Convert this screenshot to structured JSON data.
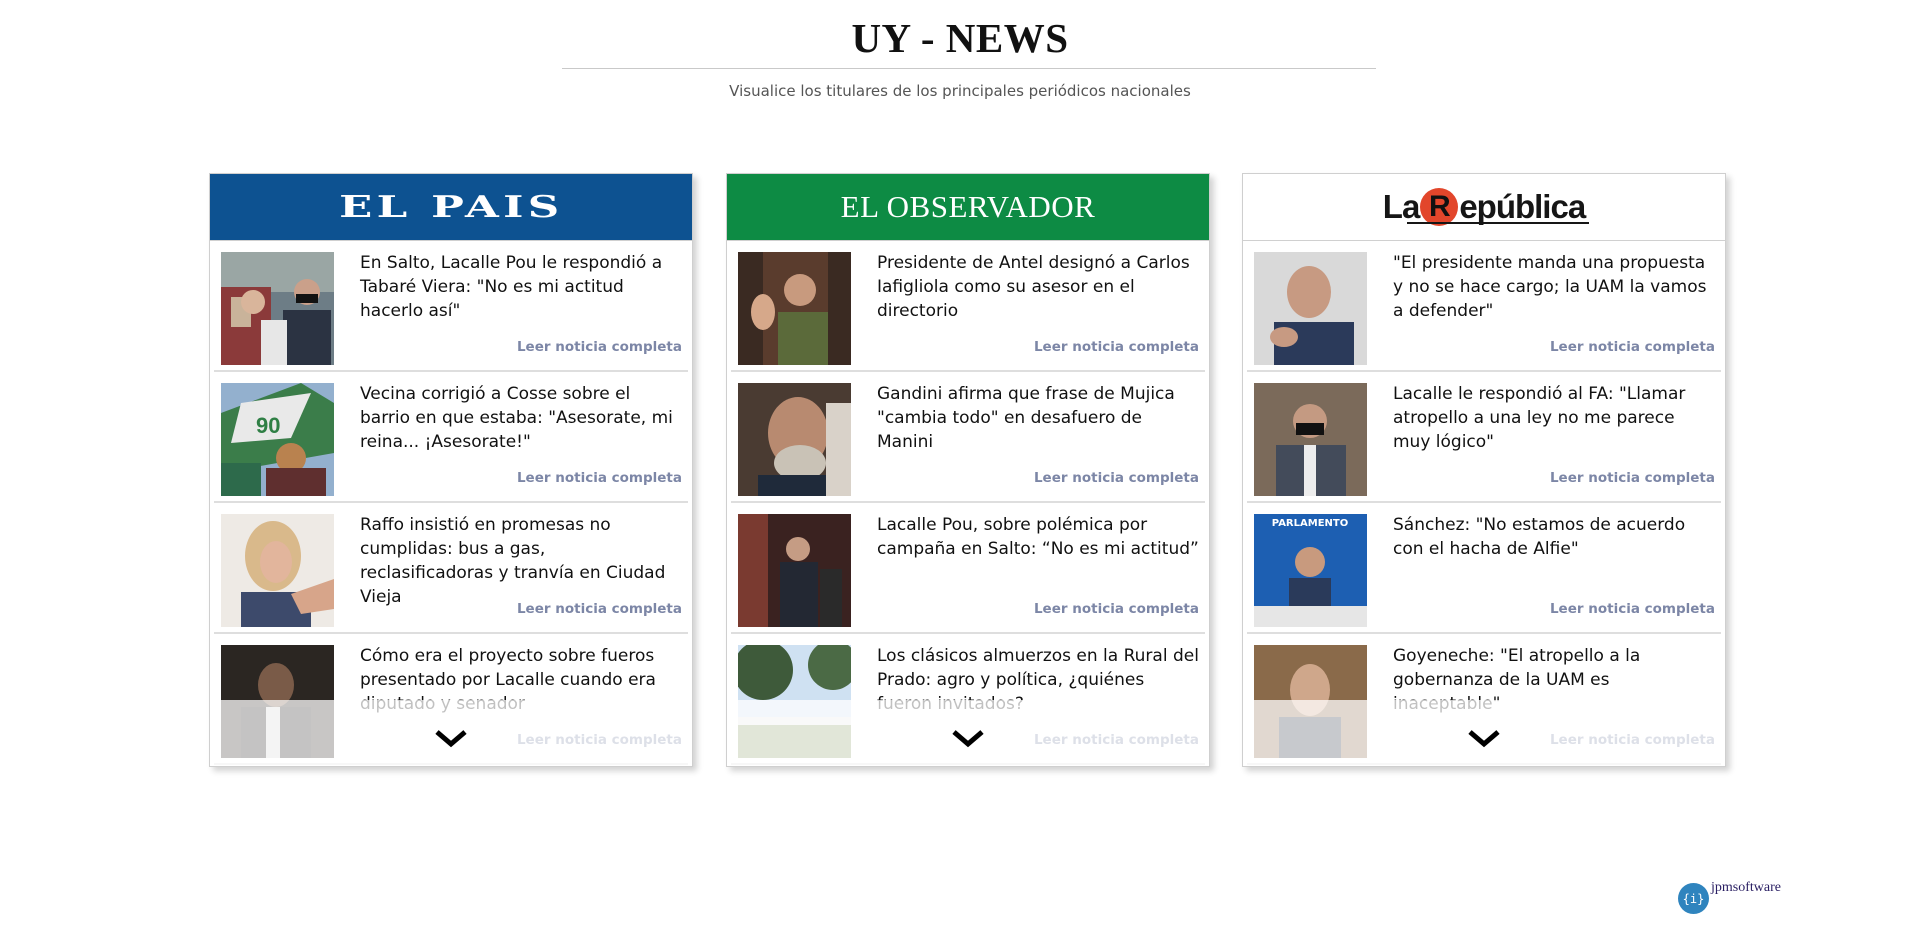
{
  "site": {
    "title": "UY - NEWS",
    "subtitle": "Visualice los titulares de los principales periódicos nacionales"
  },
  "read_more_label": "Leer noticia completa",
  "papers": [
    {
      "logo_text": "EL PAIS",
      "brand_color": "#0d5291",
      "articles": [
        {
          "headline": "En Salto, Lacalle Pou le respondió a Tabaré Viera: \"No es mi actitud hacerlo así\""
        },
        {
          "headline": "Vecina corrigió a Cosse sobre el barrio en que estaba: \"Asesorate, mi reina... ¡Asesorate!\""
        },
        {
          "headline": "Raffo insistió en promesas no cumplidas: bus a gas, reclasificadoras y tranvía en Ciudad Vieja"
        },
        {
          "headline": "Cómo era el proyecto sobre fueros presentado por Lacalle cuando era diputado y senador"
        }
      ]
    },
    {
      "logo_text": "EL OBSERVADOR",
      "brand_color": "#0d8b44",
      "articles": [
        {
          "headline": "Presidente de Antel designó a Carlos Iafigliola como su asesor en el directorio"
        },
        {
          "headline": "Gandini afirma que frase de Mujica \"cambia todo\" en desafuero de Manini"
        },
        {
          "headline": "Lacalle Pou, sobre polémica por campaña en Salto: “No es mi actitud”"
        },
        {
          "headline": "Los clásicos almuerzos en la Rural del Prado: agro y política, ¿quiénes fueron invitados?"
        }
      ]
    },
    {
      "logo_text_prefix": "La",
      "logo_text_letter": "R",
      "logo_text_suffix": "epública",
      "brand_color": "#e2462b",
      "articles": [
        {
          "headline": "\"El presidente manda una propuesta y no se hace cargo; la UAM la vamos a defender\""
        },
        {
          "headline": "Lacalle le respondió al FA: \"Llamar atropello a una ley no me parece muy lógico\""
        },
        {
          "headline": "Sánchez: \"No estamos de acuerdo con el hacha de Alfie\"",
          "photo_banner": "PARLAMENTO"
        },
        {
          "headline": "Goyeneche: \"El atropello a la gobernanza de la UAM es inaceptable\""
        }
      ]
    }
  ],
  "footer": {
    "badge_icon": "{i}",
    "badge_text": "jpmsoftware"
  }
}
